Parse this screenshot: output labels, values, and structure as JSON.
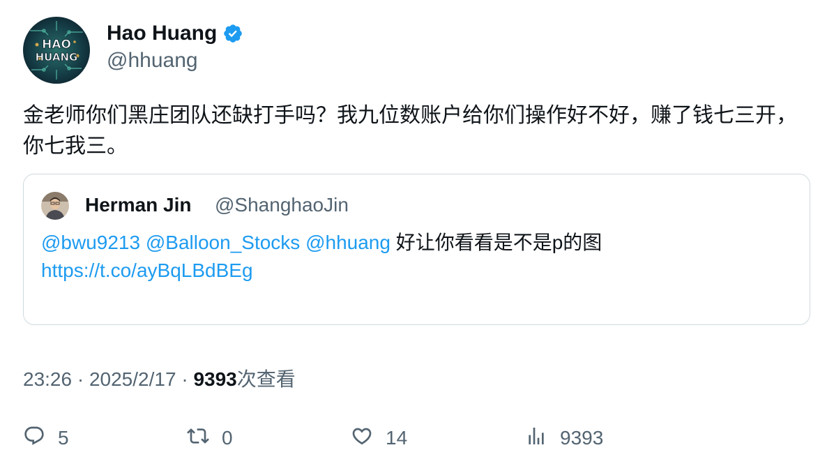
{
  "author": {
    "display_name": "Hao Huang",
    "handle": "@hhuang",
    "avatar_text_line1": "HAO",
    "avatar_text_line2": "HUANG",
    "verified_icon": "verified-badge-icon"
  },
  "tweet": {
    "text": "金老师你们黑庄团队还缺打手吗？我九位数账户给你们操作好不好，赚了钱七三开，你七我三。"
  },
  "quote": {
    "display_name": "Herman Jin",
    "handle": "@ShanghaoJin",
    "mention1": "@bwu9213",
    "mention2": "@Balloon_Stocks",
    "mention3": "@hhuang",
    "text": "好让你看看是不是p的图",
    "link": "https://t.co/ayBqLBdBEg"
  },
  "meta": {
    "time": "23:26",
    "sep1": " · ",
    "date": "2025/2/17",
    "sep2": " · ",
    "views_count": "9393",
    "views_label": "次查看"
  },
  "actions": {
    "reply_count": "5",
    "retweet_count": "0",
    "like_count": "14",
    "views_count": "9393"
  },
  "colors": {
    "link": "#1d9bf0",
    "secondary_text": "#536471",
    "primary_text": "#0f1419",
    "border": "#cfd9de"
  }
}
